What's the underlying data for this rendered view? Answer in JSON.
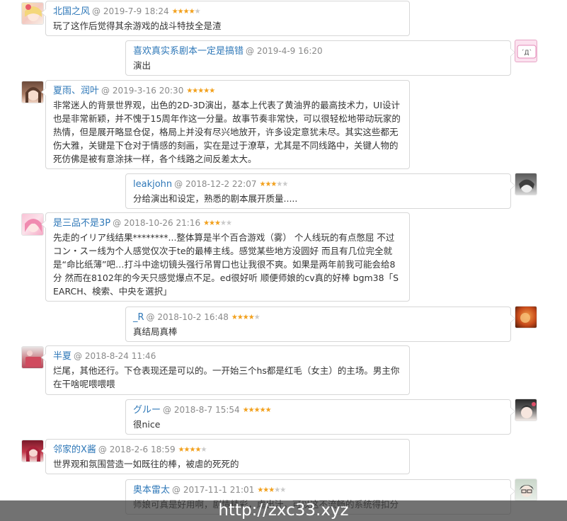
{
  "comments": [
    {
      "user": "北国之风",
      "date": "@ 2019-7-9 18:24",
      "rating": 4,
      "text": "玩了这作后觉得其余游戏的战斗特技全是渣"
    },
    {
      "user": "喜欢真实系剧本一定是搞错",
      "date": "@ 2019-4-9 16:20",
      "rating": 0,
      "text": "演出"
    },
    {
      "user": "夏雨、润叶",
      "date": "@ 2019-3-16 20:30",
      "rating": 5,
      "text": "非常迷人的背景世界观，出色的2D-3D演出，基本上代表了黄油界的最高技术力，UI设计也是非常新颖，并不愧于15周年作这一分量。故事节奏非常快，可以很轻松地带动玩家的热情，但是展开略显仓促，格局上并没有尽兴地放开，许多设定意犹未尽。其实这些都无伤大雅，关键是下仓对于情感的刻画，实在是过于潦草，尤其是不同线路中，关键人物的死仿佛是被有意涂抹一样，各个线路之间反差太大。"
    },
    {
      "user": "leakjohn",
      "date": "@ 2018-12-2 22:07",
      "rating": 3,
      "text": "分给演出和设定，熟悉的剧本展开质量....."
    },
    {
      "user": "是三品不是3P",
      "date": "@ 2018-10-26 21:16",
      "rating": 3,
      "text": "先走的イリア线结果********...整体算是半个百合游戏（雾） 个人线玩的有点憋屈 不过コン・スー线为个人感觉仅次于te的最棒主线。感觉某些地方没圆好 而且有几位完全就是“命比纸薄”吧…打斗中途切镜头强行吊胃口也让我很不爽。如果是两年前我可能会给8分 然而在8102年的今天只感觉爆点不足。ed很好听 顺便师娘的cv真的好棒 bgm38「SEARCH、検索、中央を選択」"
    },
    {
      "user": "_R",
      "date": "@ 2018-10-2 16:48",
      "rating": 4,
      "text": "真结局真棒"
    },
    {
      "user": "半夏",
      "date": "@ 2018-8-24 11:46",
      "rating": 0,
      "text": "烂尾，其他还行。下仓表现还是可以的。一开始三个hs都是红毛（女主）的主场。男主你在干啥呢喂喂喂"
    },
    {
      "user": "グルー",
      "date": "@ 2018-8-7 15:54",
      "rating": 5,
      "text": "很nice"
    },
    {
      "user": "邻家的X酱",
      "date": "@ 2018-2-6 18:59",
      "rating": 4,
      "text": "世界观和氛围营造一如既往的棒，被虐的死死的"
    },
    {
      "user": "奥本雷太",
      "date": "@ 2017-11-1 21:01",
      "rating": 3,
      "text": "师娘可真是好用啊，剧情精彩，虐出汁，可以这不流畅的系统得扣分"
    }
  ],
  "footer": {
    "url": "http://zxc33.xyz"
  },
  "colors": {
    "username": "#2f78b8",
    "star_on": "#f2a01c",
    "star_off": "#c9c9c9"
  }
}
